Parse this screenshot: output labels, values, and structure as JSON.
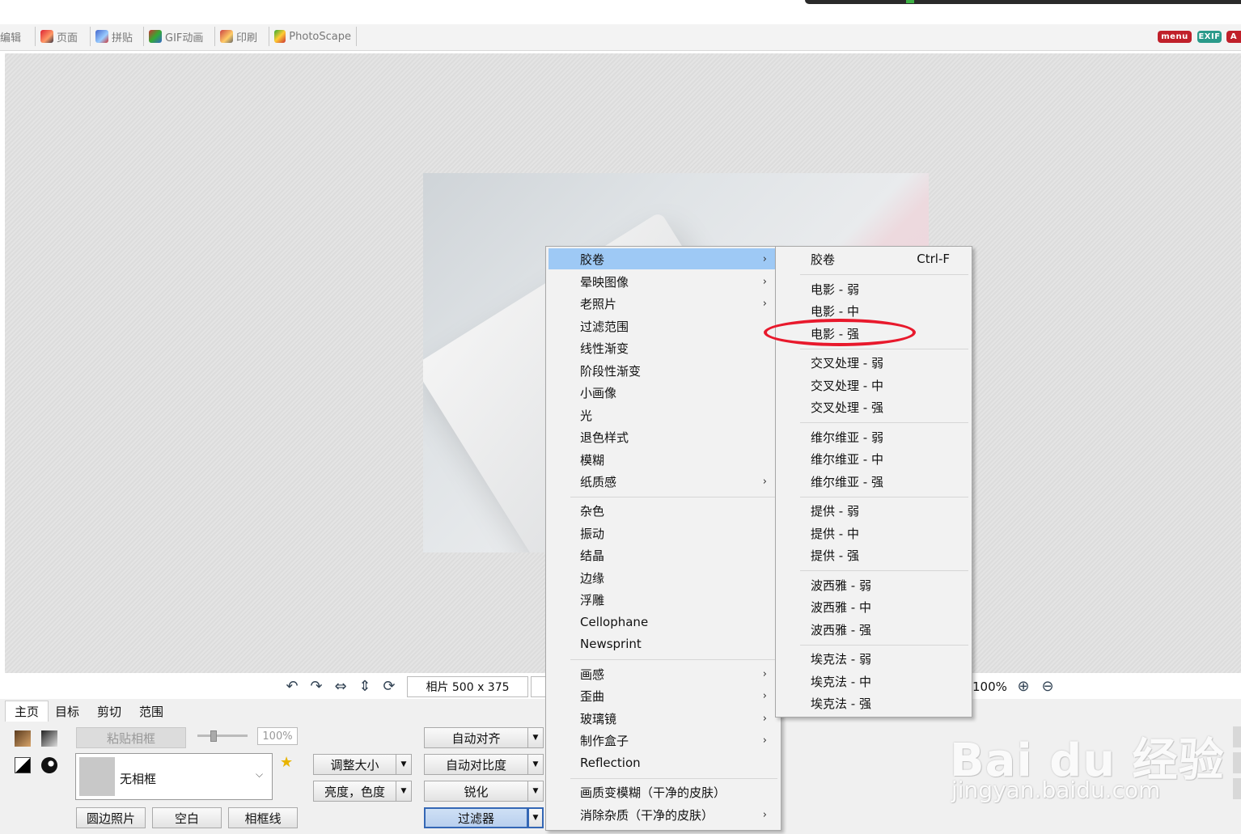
{
  "module_tabs": [
    {
      "label": "编辑",
      "icon": "edit-icon"
    },
    {
      "label": "页面",
      "icon": "page-icon"
    },
    {
      "label": "拼贴",
      "icon": "combine-icon"
    },
    {
      "label": "GIF动画",
      "icon": "gif-icon"
    },
    {
      "label": "印刷",
      "icon": "print-icon"
    },
    {
      "label": "PhotoScape",
      "icon": "photoscape-icon"
    }
  ],
  "top_badges": {
    "menu": "menu",
    "exif": "EXIF",
    "a": "A"
  },
  "status": {
    "photo_info": "相片 500 x 375",
    "zoom": "100%"
  },
  "panel_tabs": [
    "主页",
    "目标",
    "剪切",
    "范围"
  ],
  "frame": {
    "paste_label": "粘贴相框",
    "percent": "100%",
    "selected_frame": "无相框",
    "round_photo": "圆边照片",
    "blank": "空白",
    "frame_line": "相框线"
  },
  "adjust": {
    "resize": "调整大小",
    "brightness": "亮度，色度",
    "auto_level": "自动对齐",
    "auto_contrast": "自动对比度",
    "sharpen": "锐化",
    "filter": "过滤器"
  },
  "filter_menu": {
    "group1": [
      {
        "label": "胶卷",
        "submenu": true,
        "highlighted": true
      },
      {
        "label": "晕映图像",
        "submenu": true
      },
      {
        "label": "老照片",
        "submenu": true
      },
      {
        "label": "过滤范围",
        "submenu": false
      },
      {
        "label": "线性渐变",
        "submenu": false
      },
      {
        "label": "阶段性渐变",
        "submenu": false
      },
      {
        "label": "小画像",
        "submenu": false
      },
      {
        "label": "光",
        "submenu": false
      },
      {
        "label": "退色样式",
        "submenu": false
      },
      {
        "label": "模糊",
        "submenu": false
      },
      {
        "label": "纸质感",
        "submenu": true
      }
    ],
    "group2": [
      {
        "label": "杂色",
        "submenu": false
      },
      {
        "label": "振动",
        "submenu": false
      },
      {
        "label": "结晶",
        "submenu": false
      },
      {
        "label": "边缘",
        "submenu": false
      },
      {
        "label": "浮雕",
        "submenu": false
      },
      {
        "label": "Cellophane",
        "submenu": false
      },
      {
        "label": "Newsprint",
        "submenu": false
      }
    ],
    "group3": [
      {
        "label": "画感",
        "submenu": true
      },
      {
        "label": "歪曲",
        "submenu": true
      },
      {
        "label": "玻璃镜",
        "submenu": true
      },
      {
        "label": "制作盒子",
        "submenu": true
      },
      {
        "label": "Reflection",
        "submenu": false
      }
    ],
    "group4": [
      {
        "label": "画质变模糊（干净的皮肤）",
        "submenu": false
      },
      {
        "label": "消除杂质（干净的皮肤）",
        "submenu": true
      }
    ]
  },
  "film_submenu": {
    "header": {
      "label": "胶卷",
      "shortcut": "Ctrl-F"
    },
    "groups": [
      [
        "电影 - 弱",
        "电影 - 中",
        "电影 - 强"
      ],
      [
        "交叉处理 - 弱",
        "交叉处理 - 中",
        "交叉处理 - 强"
      ],
      [
        "维尔维亚 - 弱",
        "维尔维亚 - 中",
        "维尔维亚 - 强"
      ],
      [
        "提供 - 弱",
        "提供 - 中",
        "提供 - 强"
      ],
      [
        "波西雅 - 弱",
        "波西雅 - 中",
        "波西雅 - 强"
      ],
      [
        "埃克法 - 弱",
        "埃克法 - 中",
        "埃克法 - 强"
      ]
    ],
    "circled_item": "电影 - 强"
  },
  "watermark": {
    "main": "Bai du 经验",
    "sub": "jingyan.baidu.com"
  },
  "colors": {
    "menu_highlight": "#9ec9f5",
    "annotation_red": "#e8192c",
    "menu_bg": "#f2f2f2"
  }
}
